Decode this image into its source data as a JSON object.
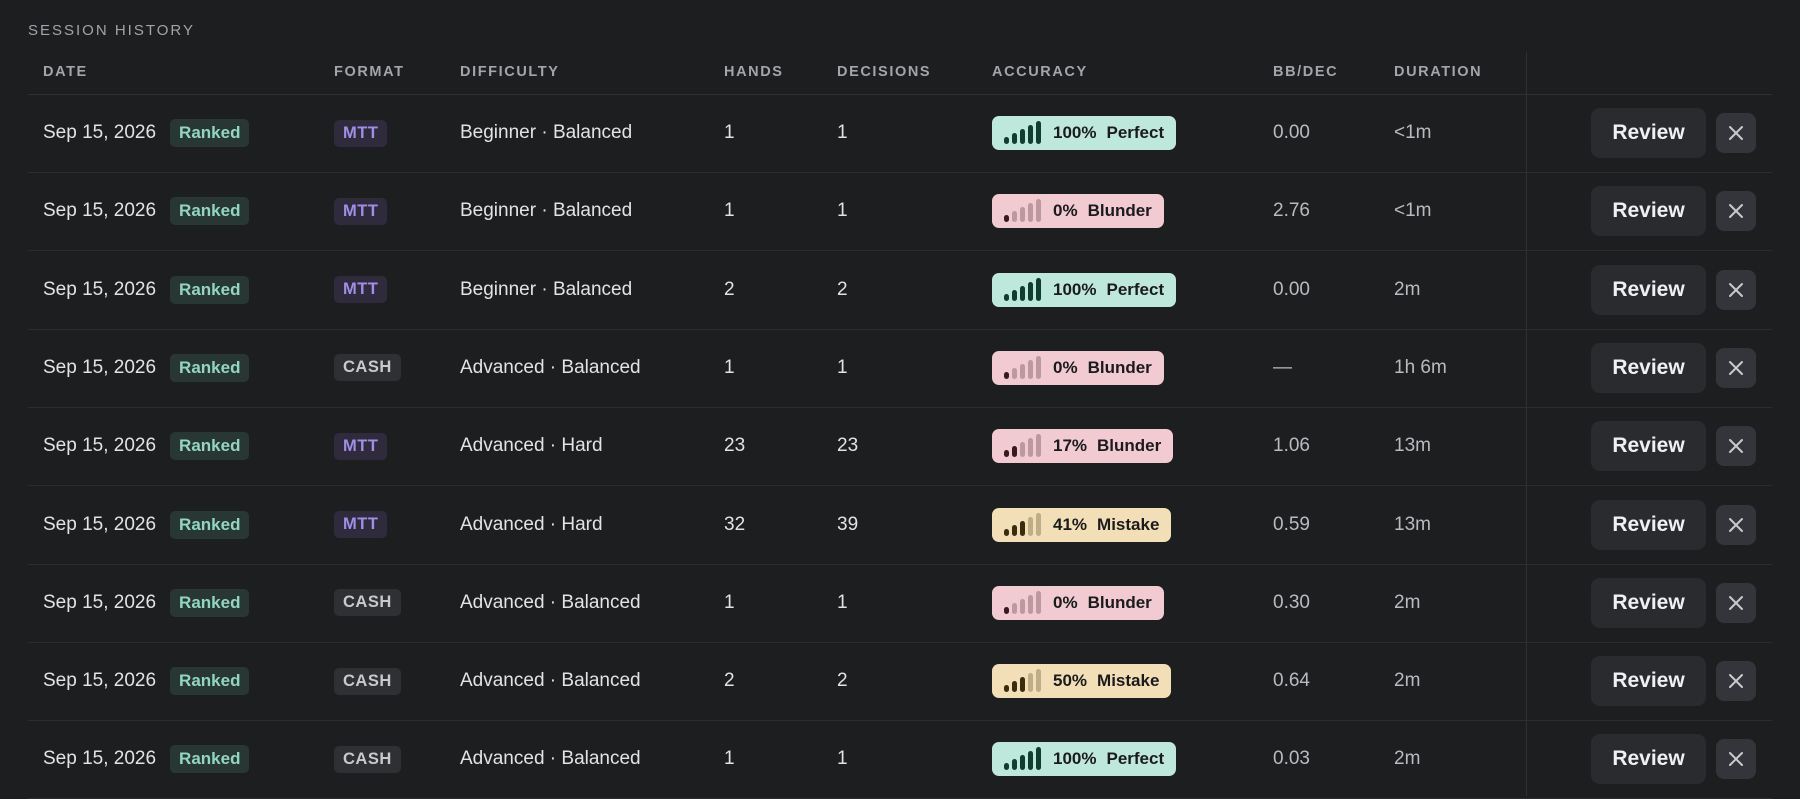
{
  "section_title": "SESSION HISTORY",
  "columns": [
    "DATE",
    "FORMAT",
    "DIFFICULTY",
    "HANDS",
    "DECISIONS",
    "ACCURACY",
    "BB/DEC",
    "DURATION"
  ],
  "review_label": "Review",
  "colors": {
    "perfect_bg": "#bfe8dc",
    "perfect_bar": "#0f3d30",
    "blunder_bg": "#f1cad2",
    "blunder_bar": "#3a1a21",
    "mistake_bg": "#f3dfb7",
    "mistake_bar": "#3a2c0f"
  },
  "rows": [
    {
      "date": "Sep 15, 2026",
      "badge": "Ranked",
      "format": "MTT",
      "difficulty": "Beginner · Balanced",
      "hands": "1",
      "decisions": "1",
      "accuracy": {
        "pct": "100%",
        "label": "Perfect",
        "level": "perfect",
        "filled_bars": 5
      },
      "bb_dec": "0.00",
      "duration": "<1m"
    },
    {
      "date": "Sep 15, 2026",
      "badge": "Ranked",
      "format": "MTT",
      "difficulty": "Beginner · Balanced",
      "hands": "1",
      "decisions": "1",
      "accuracy": {
        "pct": "0%",
        "label": "Blunder",
        "level": "blunder",
        "filled_bars": 1
      },
      "bb_dec": "2.76",
      "duration": "<1m"
    },
    {
      "date": "Sep 15, 2026",
      "badge": "Ranked",
      "format": "MTT",
      "difficulty": "Beginner · Balanced",
      "hands": "2",
      "decisions": "2",
      "accuracy": {
        "pct": "100%",
        "label": "Perfect",
        "level": "perfect",
        "filled_bars": 5
      },
      "bb_dec": "0.00",
      "duration": "2m"
    },
    {
      "date": "Sep 15, 2026",
      "badge": "Ranked",
      "format": "CASH",
      "difficulty": "Advanced · Balanced",
      "hands": "1",
      "decisions": "1",
      "accuracy": {
        "pct": "0%",
        "label": "Blunder",
        "level": "blunder",
        "filled_bars": 1
      },
      "bb_dec": "—",
      "duration": "1h 6m"
    },
    {
      "date": "Sep 15, 2026",
      "badge": "Ranked",
      "format": "MTT",
      "difficulty": "Advanced · Hard",
      "hands": "23",
      "decisions": "23",
      "accuracy": {
        "pct": "17%",
        "label": "Blunder",
        "level": "blunder",
        "filled_bars": 2
      },
      "bb_dec": "1.06",
      "duration": "13m"
    },
    {
      "date": "Sep 15, 2026",
      "badge": "Ranked",
      "format": "MTT",
      "difficulty": "Advanced · Hard",
      "hands": "32",
      "decisions": "39",
      "accuracy": {
        "pct": "41%",
        "label": "Mistake",
        "level": "mistake",
        "filled_bars": 3
      },
      "bb_dec": "0.59",
      "duration": "13m"
    },
    {
      "date": "Sep 15, 2026",
      "badge": "Ranked",
      "format": "CASH",
      "difficulty": "Advanced · Balanced",
      "hands": "1",
      "decisions": "1",
      "accuracy": {
        "pct": "0%",
        "label": "Blunder",
        "level": "blunder",
        "filled_bars": 1
      },
      "bb_dec": "0.30",
      "duration": "2m"
    },
    {
      "date": "Sep 15, 2026",
      "badge": "Ranked",
      "format": "CASH",
      "difficulty": "Advanced · Balanced",
      "hands": "2",
      "decisions": "2",
      "accuracy": {
        "pct": "50%",
        "label": "Mistake",
        "level": "mistake",
        "filled_bars": 3
      },
      "bb_dec": "0.64",
      "duration": "2m"
    },
    {
      "date": "Sep 15, 2026",
      "badge": "Ranked",
      "format": "CASH",
      "difficulty": "Advanced · Balanced",
      "hands": "1",
      "decisions": "1",
      "accuracy": {
        "pct": "100%",
        "label": "Perfect",
        "level": "perfect",
        "filled_bars": 5
      },
      "bb_dec": "0.03",
      "duration": "2m"
    }
  ]
}
